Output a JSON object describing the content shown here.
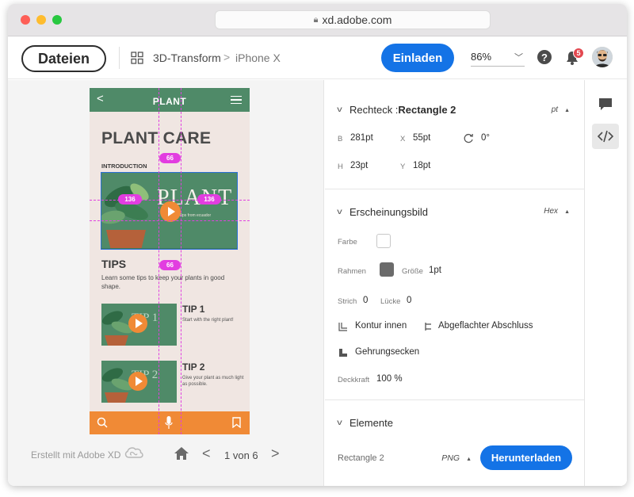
{
  "browser": {
    "url": "xd.adobe.com"
  },
  "header": {
    "files_button": "Dateien",
    "breadcrumb_project": "3D-Transform",
    "breadcrumb_sep": ">",
    "breadcrumb_artboard": "iPhone X",
    "invite_button": "Einladen",
    "zoom_level": "86%",
    "help_label": "?",
    "notification_count": "5"
  },
  "artboard": {
    "header_title": "PLANT",
    "back_glyph": "<",
    "heading": "PLANT CARE",
    "intro_label": "INTRODUCTION",
    "hero_text": "PLANT",
    "hero_subtext": "Tips from ecuador",
    "tips_heading": "TIPS",
    "tips_subtext": "Learn some tips to keep your plants in good shape.",
    "tips": [
      {
        "thumb_text": "TIP 1",
        "title": "TIP 1",
        "subtitle": "Start with the right plant!"
      },
      {
        "thumb_text": "TIP 2",
        "title": "TIP 2",
        "subtitle": "Give your plant as much light as possible."
      }
    ],
    "measurements": {
      "top": "66",
      "left": "136",
      "right": "136",
      "bottom": "66"
    }
  },
  "canvas_footer": {
    "created_with": "Erstellt mit Adobe XD",
    "page_indicator": "1 von 6",
    "prev_glyph": "<",
    "next_glyph": ">"
  },
  "inspector": {
    "rect_section": {
      "type_label": "Rechteck : ",
      "name": "Rectangle 2",
      "unit": "pt",
      "width_label": "B",
      "width_value": "281pt",
      "x_label": "X",
      "x_value": "55pt",
      "rotation_value": "0°",
      "height_label": "H",
      "height_value": "23pt",
      "y_label": "Y",
      "y_value": "18pt"
    },
    "appearance_section": {
      "title": "Erscheinungsbild",
      "color_mode": "Hex",
      "fill_label": "Farbe",
      "fill_color": "#ffffff",
      "border_label": "Rahmen",
      "border_color": "#6b6b6b",
      "size_label": "Größe",
      "size_value": "1pt",
      "dash_label": "Strich",
      "dash_value": "0",
      "gap_label": "Lücke",
      "gap_value": "0",
      "stroke_inside": "Kontur innen",
      "flat_cap": "Abgeflachter Abschluss",
      "miter_join": "Gehrungsecken",
      "opacity_label": "Deckkraft",
      "opacity_value": "100 %"
    },
    "elements_section": {
      "title": "Elemente",
      "asset_name": "Rectangle 2",
      "format": "PNG",
      "download_button": "Herunterladen"
    }
  },
  "colors": {
    "accent_blue": "#1473e6",
    "plant_green": "#4f8a68",
    "orange": "#f08a36",
    "guide_magenta": "#e23de0"
  }
}
